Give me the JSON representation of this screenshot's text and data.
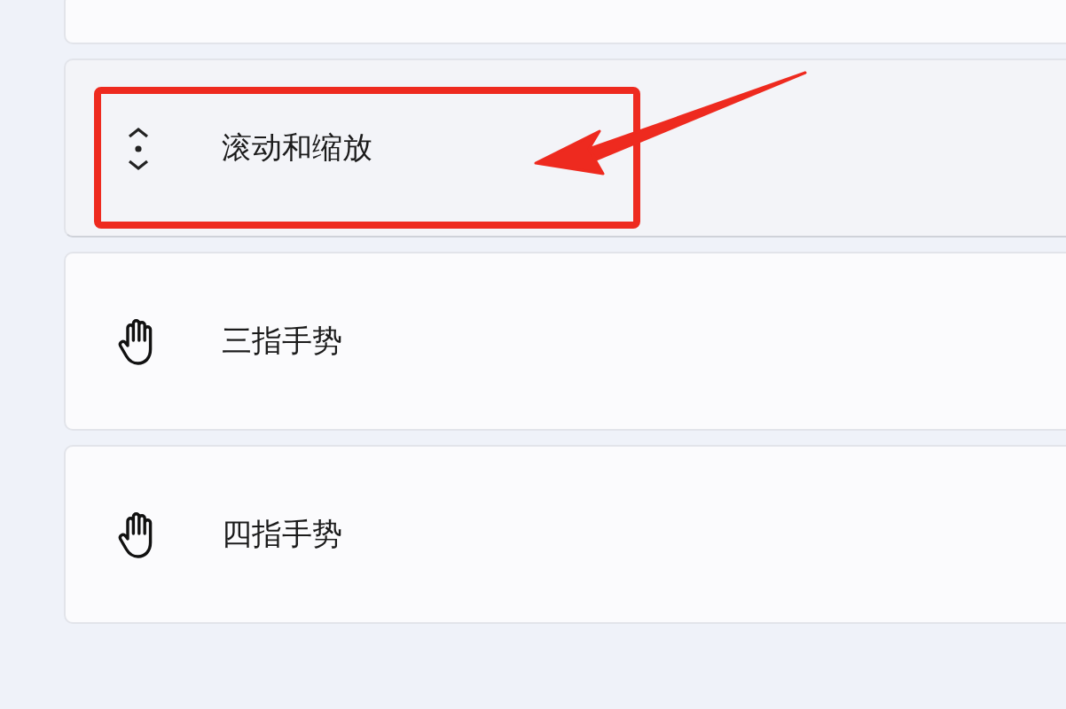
{
  "settings_items": [
    {
      "kind": "scroll",
      "label": "滚动和缩放",
      "selected": true
    },
    {
      "kind": "hand",
      "label": "三指手势",
      "selected": false
    },
    {
      "kind": "hand",
      "label": "四指手势",
      "selected": false
    }
  ]
}
